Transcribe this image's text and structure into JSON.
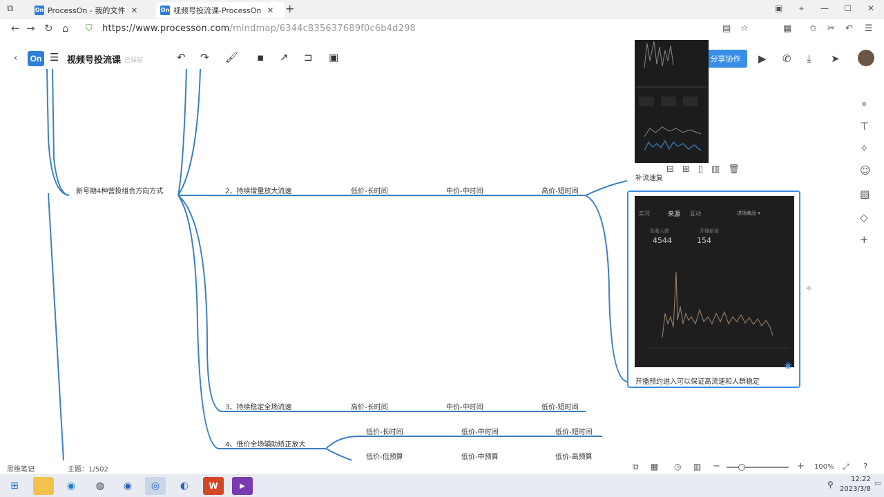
{
  "browser": {
    "tabs": [
      {
        "title": "ProcessOn - 我的文件",
        "icon": "processon-icon"
      },
      {
        "title": "视频号投流课-ProcessOn",
        "icon": "processon-icon"
      }
    ],
    "new_tab": "+",
    "url_main": "https://www.processon.com",
    "url_rest": "/mindmap/6344c835637689f0c6b4d298"
  },
  "app": {
    "logo": "On",
    "title": "视频号投流课",
    "subtitle": "已保存",
    "share_label": "分享协作"
  },
  "mindmap": {
    "branch_main": "新号期4种营投组合方向方式",
    "b2": {
      "label": "2、持续增量放大流速",
      "c1": "低价-长时间",
      "c2": "中价-中时间",
      "c3": "高价-短时间",
      "c4": "补流速复"
    },
    "b3": {
      "label": "3、持续稳定全场流速",
      "c1": "高价-长时间",
      "c2": "中价-中时间",
      "c3": "低价-短时间"
    },
    "b4": {
      "label": "4、低价全场辅助矫正放大",
      "c1": "低价-长时间",
      "c2": "低价-中时间",
      "c3": "低价-短时间",
      "d1": "低价-低预算",
      "d2": "低价-中预算",
      "d3": "低价-高预算"
    },
    "image_caption": "开播预约进入可以保证高流速和人群稳定",
    "shot2": {
      "tab1": "实况",
      "tab2": "来源",
      "tab3": "互动",
      "filter": "进场商品 ▾",
      "metric1_label": "观看人数",
      "metric1_value": "4544",
      "metric2_label": "开播新增",
      "metric2_value": "154"
    }
  },
  "statusbar": {
    "left": "思维笔记",
    "topics": "主题：1/502",
    "zoom": "100%"
  },
  "taskbar": {
    "time": "12:22",
    "date": "2023/3/8"
  },
  "colors": {
    "accent": "#3a8ee6",
    "line": "#3a7fc4"
  }
}
